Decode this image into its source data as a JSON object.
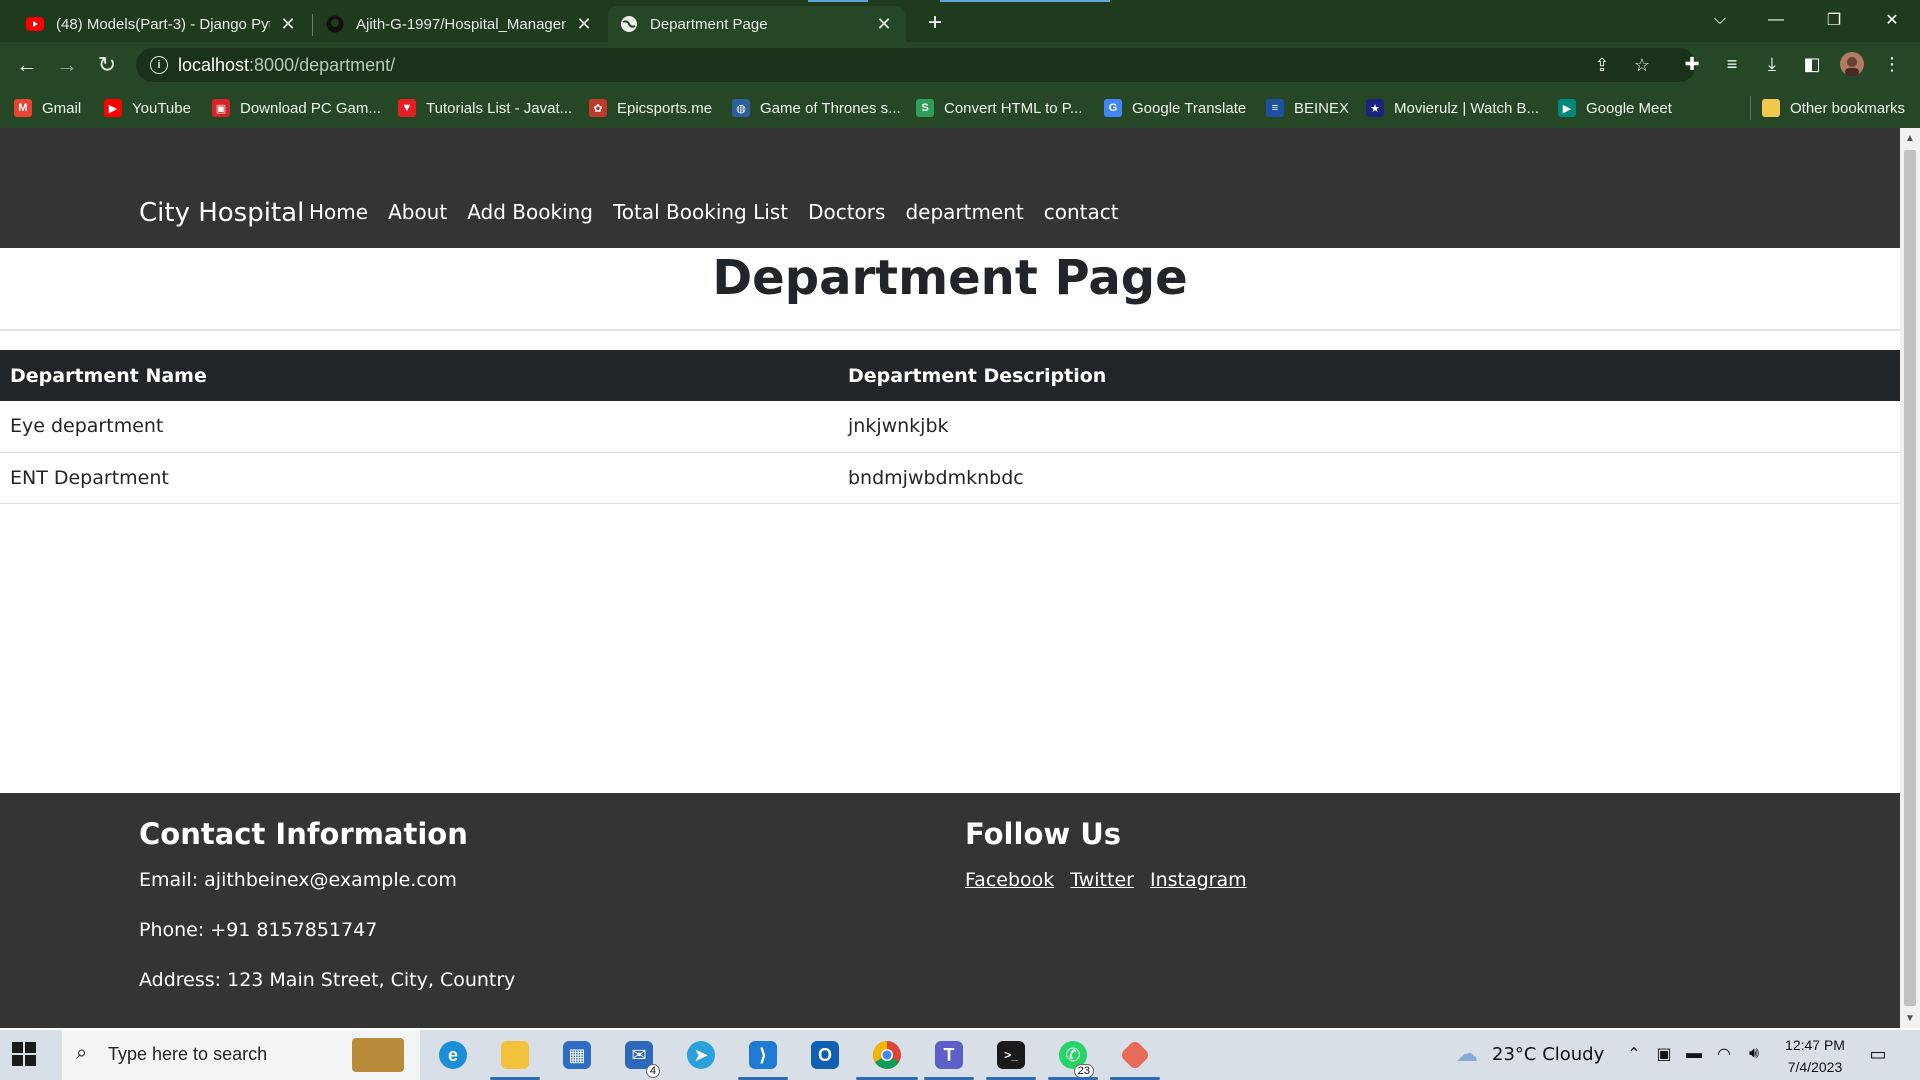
{
  "browser": {
    "tabs": [
      {
        "title": "(48) Models(Part-3) - Django Pyth",
        "icon": "youtube-icon",
        "active": false
      },
      {
        "title": "Ajith-G-1997/Hospital_Managem",
        "icon": "github-icon",
        "active": false
      },
      {
        "title": "Department Page",
        "icon": "globe-icon",
        "active": true
      }
    ],
    "url_host": "localhost",
    "url_path": ":8000/department/",
    "bookmarks": [
      {
        "label": "Gmail",
        "color": "#ea4335",
        "glyph": "M"
      },
      {
        "label": "YouTube",
        "color": "#ff0000",
        "glyph": "▶"
      },
      {
        "label": "Download PC Gam...",
        "color": "#d9232a",
        "glyph": "▣"
      },
      {
        "label": "Tutorials List - Javat...",
        "color": "#e31e24",
        "glyph": "▼"
      },
      {
        "label": "Epicsports.me",
        "color": "#c0392b",
        "glyph": "✿"
      },
      {
        "label": "Game of Thrones s...",
        "color": "#2e5e9e",
        "glyph": "◍"
      },
      {
        "label": "Convert HTML to P...",
        "color": "#2e9e5a",
        "glyph": "S"
      },
      {
        "label": "Google Translate",
        "color": "#4285f4",
        "glyph": "G"
      },
      {
        "label": "BEINEX",
        "color": "#1f4fa0",
        "glyph": "≡"
      },
      {
        "label": "Movierulz | Watch B...",
        "color": "#1a237e",
        "glyph": "★"
      },
      {
        "label": "Google Meet",
        "color": "#00897b",
        "glyph": "▶"
      }
    ],
    "other_bookmarks": "Other bookmarks"
  },
  "site": {
    "brand": "City Hospital",
    "nav": [
      "Home",
      "About",
      "Add Booking",
      "Total Booking List",
      "Doctors",
      "department",
      "contact"
    ],
    "page_title": "Department Page",
    "table": {
      "headers": [
        "Department Name",
        "Department Description"
      ],
      "rows": [
        [
          "Eye department",
          "jnkjwnkjbk"
        ],
        [
          "ENT Department",
          "bndmjwbdmknbdc"
        ]
      ]
    },
    "footer": {
      "contact_heading": "Contact Information",
      "email": "Email: ajithbeinex@example.com",
      "phone": "Phone: +91 8157851747",
      "address": "Address: 123 Main Street, City, Country",
      "follow_heading": "Follow Us",
      "social": [
        "Facebook",
        "Twitter",
        "Instagram"
      ]
    }
  },
  "taskbar": {
    "search_placeholder": "Type here to search",
    "mail_badge": "4",
    "whatsapp_badge": "23",
    "weather": "23°C  Cloudy",
    "time": "12:47 PM",
    "date": "7/4/2023"
  }
}
